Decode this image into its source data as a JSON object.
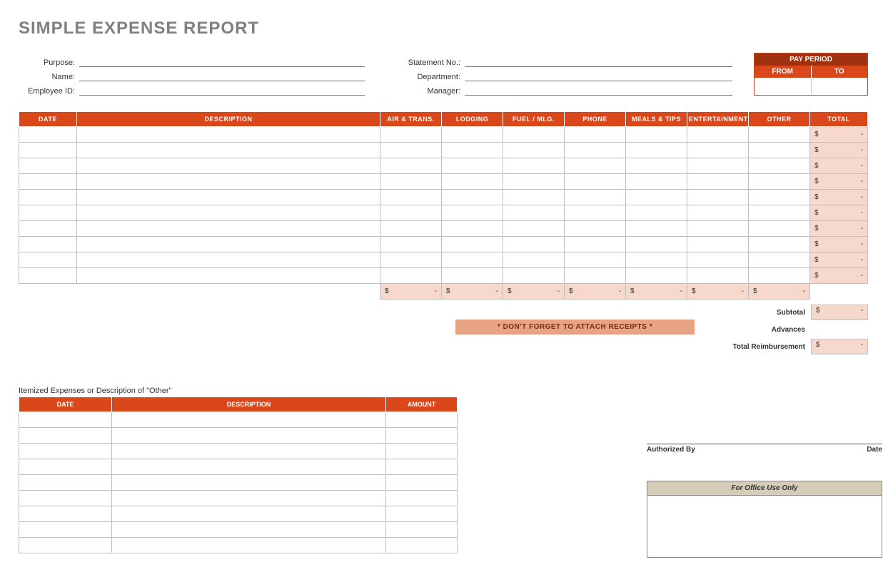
{
  "title": "SIMPLE EXPENSE REPORT",
  "info_left": [
    {
      "label": "Purpose:"
    },
    {
      "label": "Name:"
    },
    {
      "label": "Employee ID:"
    }
  ],
  "info_right": [
    {
      "label": "Statement No.:"
    },
    {
      "label": "Department:"
    },
    {
      "label": "Manager:"
    }
  ],
  "pay_period": {
    "title": "PAY PERIOD",
    "from": "FROM",
    "to": "TO"
  },
  "columns": {
    "date": "DATE",
    "description": "DESCRIPTION",
    "air": "AIR & TRANS.",
    "lodging": "LODGING",
    "fuel": "FUEL / MLG.",
    "phone": "PHONE",
    "meals": "MEALS & TIPS",
    "entertainment": "ENTERTAINMENT",
    "other": "OTHER",
    "total": "TOTAL"
  },
  "rows": [
    {
      "total_cur": "$",
      "total_val": "-"
    },
    {
      "total_cur": "$",
      "total_val": "-"
    },
    {
      "total_cur": "$",
      "total_val": "-"
    },
    {
      "total_cur": "$",
      "total_val": "-"
    },
    {
      "total_cur": "$",
      "total_val": "-"
    },
    {
      "total_cur": "$",
      "total_val": "-"
    },
    {
      "total_cur": "$",
      "total_val": "-"
    },
    {
      "total_cur": "$",
      "total_val": "-"
    },
    {
      "total_cur": "$",
      "total_val": "-"
    },
    {
      "total_cur": "$",
      "total_val": "-"
    }
  ],
  "col_sums": [
    {
      "cur": "$",
      "val": "-"
    },
    {
      "cur": "$",
      "val": "-"
    },
    {
      "cur": "$",
      "val": "-"
    },
    {
      "cur": "$",
      "val": "-"
    },
    {
      "cur": "$",
      "val": "-"
    },
    {
      "cur": "$",
      "val": "-"
    },
    {
      "cur": "$",
      "val": "-"
    }
  ],
  "receipts_note": "* DON'T FORGET TO ATTACH RECEIPTS *",
  "summary": {
    "subtotal_label": "Subtotal",
    "subtotal_cur": "$",
    "subtotal_val": "-",
    "advances_label": "Advances",
    "reimb_label": "Total Reimbursement",
    "reimb_cur": "$",
    "reimb_val": "-"
  },
  "itemized": {
    "caption": "Itemized Expenses or Description of \"Other\"",
    "cols": {
      "date": "DATE",
      "description": "DESCRIPTION",
      "amount": "AMOUNT"
    },
    "row_count": 9
  },
  "sign": {
    "authorized": "Authorized By",
    "date": "Date",
    "office": "For Office Use Only"
  }
}
